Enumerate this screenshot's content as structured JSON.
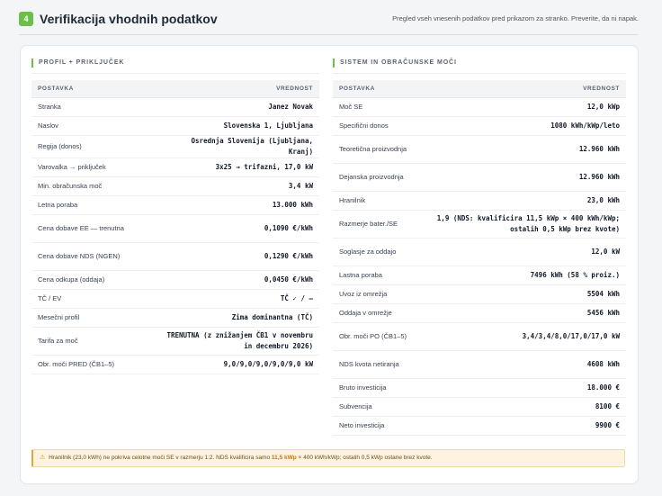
{
  "header": {
    "step": "4",
    "title": "Verifikacija vhodnih podatkov",
    "subtitle": "Pregled vseh vnesenih podatkov pred prikazom za stranko. Preverite, da ni napak."
  },
  "left": {
    "title": "PROFIL + PRIKLJUČEK",
    "col_label": "POSTAVKA",
    "col_value": "VREDNOST",
    "rows": [
      {
        "label": "Stranka",
        "value": "Janez Novak",
        "h": 21
      },
      {
        "label": "Naslov",
        "value": "Slovenska 1, Ljubljana",
        "h": 21
      },
      {
        "label": "Regija (donos)",
        "value": "Osrednja Slovenija (Ljubljana, Kranj)",
        "h": 21
      },
      {
        "label": "Varovalka → priključek",
        "value": "3x25 → trifazni, 17,0 kW",
        "h": 21
      },
      {
        "label": "Min. obračunska moč",
        "value": "3,4 kW",
        "h": 21
      },
      {
        "label": "Letna poraba",
        "value": "13.000 kWh",
        "h": 21
      },
      {
        "label": "Cena dobave EE — trenutna",
        "value": "0,1090 €/kWh",
        "h": 31
      },
      {
        "label": "Cena dobave NDS (NGEN)",
        "value": "0,1290 €/kWh",
        "h": 31
      },
      {
        "label": "Cena odkupa (oddaja)",
        "value": "0,0450 €/kWh",
        "h": 21
      },
      {
        "label": "TČ / EV",
        "value": "TČ ✓ / —",
        "h": 21
      },
      {
        "label": "Mesečni profil",
        "value": "Zima dominantna (TČ)",
        "h": 21
      },
      {
        "label": "Tarifa za moč",
        "value": "TRENUTNA (z znižanjem ČB1 v novembru in decembru 2026)",
        "h": 31
      },
      {
        "label": "Obr. moči PRED (ČB1–5)",
        "value": "9,0/9,0/9,0/9,0/9,0 kW",
        "h": 21
      }
    ]
  },
  "right": {
    "title": "SISTEM IN OBRAČUNSKE MOČI",
    "col_label": "POSTAVKA",
    "col_value": "VREDNOST",
    "rows": [
      {
        "label": "Moč SE",
        "value": "12,0 kWp",
        "h": 21
      },
      {
        "label": "Specifični donos",
        "value": "1080 kWh/kWp/leto",
        "h": 21
      },
      {
        "label": "Teoretična proizvodnja",
        "value": "12.960 kWh",
        "h": 31
      },
      {
        "label": "Dejanska proizvodnja",
        "value": "12.960 kWh",
        "h": 31
      },
      {
        "label": "Hranilnik",
        "value": "23,0 kWh",
        "h": 21
      },
      {
        "label": "Razmerje bater./SE",
        "value": "1,9 (NDS: kvalificira 11,5 kWp × 400 kWh/kWp; ostalih 0,5 kWp brez kvote)",
        "h": 31
      },
      {
        "label": "Soglasje za oddajo",
        "value": "12,0 kW",
        "h": 31
      },
      {
        "label": "Lastna poraba",
        "value": "7496 kWh (58 % proiz.)",
        "h": 21
      },
      {
        "label": "Uvoz iz omrežja",
        "value": "5504 kWh",
        "h": 21
      },
      {
        "label": "Oddaja v omrežje",
        "value": "5456 kWh",
        "h": 21
      },
      {
        "label": "Obr. moči PO (ČB1–5)",
        "value": "3,4/3,4/8,0/17,0/17,0 kW",
        "h": 31
      },
      {
        "label": "NDS kvota netiranja",
        "value": "4608 kWh",
        "h": 31
      },
      {
        "label": "Bruto investicija",
        "value": "18.000 €",
        "h": 21
      },
      {
        "label": "Subvencija",
        "value": "8100 €",
        "h": 21
      },
      {
        "label": "Neto investicija",
        "value": "9900 €",
        "h": 21
      }
    ]
  },
  "notice": {
    "icon": "warning-icon",
    "text_a": "Hranilnik (23,0 kWh) ne pokriva celotne moči SE v razmerju 1:2. NDS kvalificira samo ",
    "highlight": "11,5 kWp",
    "text_b": " × 400 kWh/kWp; ostalih 0,5 kWp ostane brez kvote."
  }
}
